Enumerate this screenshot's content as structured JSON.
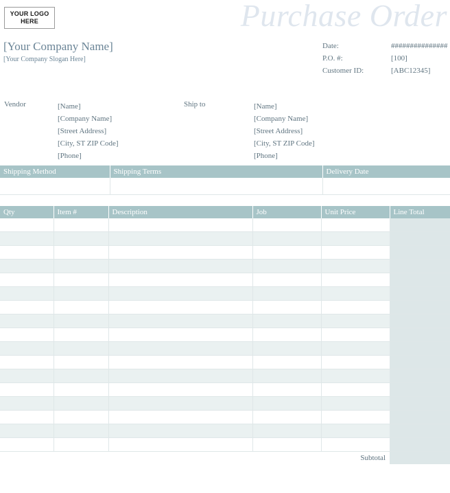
{
  "document": {
    "title": "Purchase Order"
  },
  "logo": {
    "line1": "YOUR LOGO",
    "line2": "HERE"
  },
  "company": {
    "name": "[Your Company Name]",
    "slogan": "[Your Company Slogan Here]"
  },
  "meta": {
    "rows": [
      {
        "label": "Date:",
        "value": "###############"
      },
      {
        "label": "P.O. #:",
        "value": "[100]"
      },
      {
        "label": "Customer ID:",
        "value": "[ABC12345]"
      }
    ]
  },
  "parties": {
    "vendor": {
      "label": "Vendor",
      "lines": [
        "[Name]",
        "[Company Name]",
        "[Street Address]",
        "[City, ST  ZIP Code]",
        "[Phone]"
      ]
    },
    "ship_to": {
      "label": "Ship to",
      "lines": [
        "[Name]",
        "[Company Name]",
        "[Street Address]",
        "[City, ST  ZIP Code]",
        "[Phone]"
      ]
    }
  },
  "shipping": {
    "headers": [
      "Shipping Method",
      "Shipping Terms",
      "Delivery Date"
    ],
    "values": [
      "",
      "",
      ""
    ]
  },
  "items": {
    "headers": [
      "Qty",
      "Item #",
      "Description",
      "Job",
      "Unit Price",
      "Line Total"
    ],
    "rows": [
      [
        "",
        "",
        "",
        "",
        "",
        ""
      ],
      [
        "",
        "",
        "",
        "",
        "",
        ""
      ],
      [
        "",
        "",
        "",
        "",
        "",
        ""
      ],
      [
        "",
        "",
        "",
        "",
        "",
        ""
      ],
      [
        "",
        "",
        "",
        "",
        "",
        ""
      ],
      [
        "",
        "",
        "",
        "",
        "",
        ""
      ],
      [
        "",
        "",
        "",
        "",
        "",
        ""
      ],
      [
        "",
        "",
        "",
        "",
        "",
        ""
      ],
      [
        "",
        "",
        "",
        "",
        "",
        ""
      ],
      [
        "",
        "",
        "",
        "",
        "",
        ""
      ],
      [
        "",
        "",
        "",
        "",
        "",
        ""
      ],
      [
        "",
        "",
        "",
        "",
        "",
        ""
      ],
      [
        "",
        "",
        "",
        "",
        "",
        ""
      ],
      [
        "",
        "",
        "",
        "",
        "",
        ""
      ],
      [
        "",
        "",
        "",
        "",
        "",
        ""
      ],
      [
        "",
        "",
        "",
        "",
        "",
        ""
      ],
      [
        "",
        "",
        "",
        "",
        "",
        ""
      ]
    ],
    "subtotal_label": "Subtotal",
    "subtotal_value": ""
  },
  "colors": {
    "header_fill": "#a7c4c7",
    "row_stripe": "#eaf1f1",
    "total_column": "#dde7e8",
    "text": "#5f7480",
    "title": "#dfe6ee"
  }
}
